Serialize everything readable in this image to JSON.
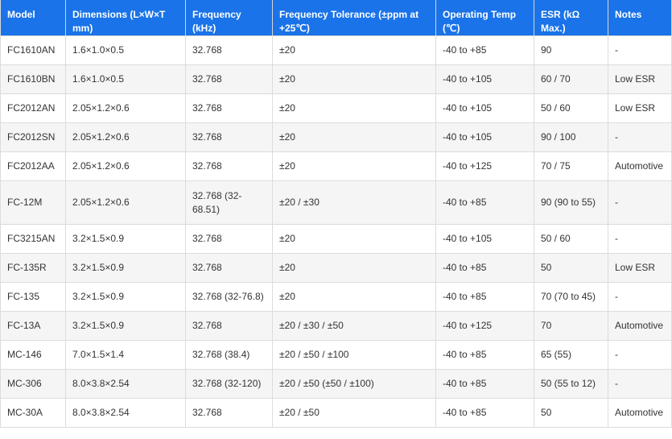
{
  "headers": [
    "Model",
    "Dimensions (L×W×T mm)",
    "Frequency (kHz)",
    "Frequency Tolerance (±ppm at +25℃)",
    "Operating Temp (℃)",
    "ESR (kΩ Max.)",
    "Notes"
  ],
  "rows": [
    [
      "FC1610AN",
      "1.6×1.0×0.5",
      "32.768",
      "±20",
      "-40 to +85",
      "90",
      "-"
    ],
    [
      "FC1610BN",
      "1.6×1.0×0.5",
      "32.768",
      "±20",
      "-40 to +105",
      "60 / 70",
      "Low ESR"
    ],
    [
      "FC2012AN",
      "2.05×1.2×0.6",
      "32.768",
      "±20",
      "-40 to +105",
      "50 / 60",
      "Low ESR"
    ],
    [
      "FC2012SN",
      "2.05×1.2×0.6",
      "32.768",
      "±20",
      "-40 to +105",
      "90 / 100",
      "-"
    ],
    [
      "FC2012AA",
      "2.05×1.2×0.6",
      "32.768",
      "±20",
      "-40 to +125",
      "70 / 75",
      "Automotive"
    ],
    [
      "FC-12M",
      "2.05×1.2×0.6",
      "32.768 (32-68.51)",
      "±20 / ±30",
      "-40 to +85",
      "90 (90 to 55)",
      "-"
    ],
    [
      "FC3215AN",
      "3.2×1.5×0.9",
      "32.768",
      "±20",
      "-40 to +105",
      "50 / 60",
      "-"
    ],
    [
      "FC-135R",
      "3.2×1.5×0.9",
      "32.768",
      "±20",
      "-40 to +85",
      "50",
      "Low ESR"
    ],
    [
      "FC-135",
      "3.2×1.5×0.9",
      "32.768 (32-76.8)",
      "±20",
      "-40 to +85",
      "70 (70 to 45)",
      "-"
    ],
    [
      "FC-13A",
      "3.2×1.5×0.9",
      "32.768",
      "±20 / ±30 / ±50",
      "-40 to +125",
      "70",
      "Automotive"
    ],
    [
      "MC-146",
      "7.0×1.5×1.4",
      "32.768 (38.4)",
      "±20 / ±50 / ±100",
      "-40 to +85",
      "65 (55)",
      "-"
    ],
    [
      "MC-306",
      "8.0×3.8×2.54",
      "32.768 (32-120)",
      "±20 / ±50 (±50 / ±100)",
      "-40 to +85",
      "50 (55 to 12)",
      "-"
    ],
    [
      "MC-30A",
      "8.0×3.8×2.54",
      "32.768",
      "±20 / ±50",
      "-40 to +85",
      "50",
      "Automotive"
    ]
  ]
}
